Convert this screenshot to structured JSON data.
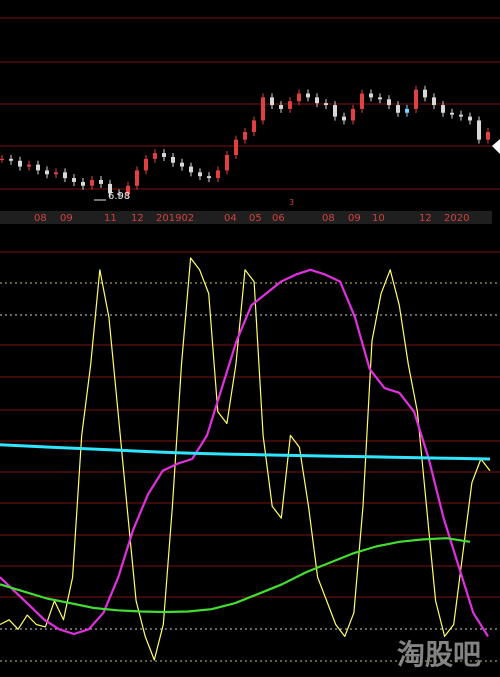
{
  "colors": {
    "background": "#000000",
    "grid_red": "#7a1414",
    "axis_bar": "#1f1f1f",
    "dotted_yellow": "#c8c070",
    "dotted_white": "#cfcfcf",
    "price_up": "#e04040",
    "price_down": "#d8d8d8",
    "price_gap": "#7fd4ff",
    "osc_yellow": "#ffff66",
    "magenta": "#e030e0",
    "cyan": "#2ee6ff",
    "green": "#44dd33",
    "watermark": "#9a9a9a",
    "label_white": "#e8e8e8",
    "tick_red": "#d04040"
  },
  "watermark": "淘股吧",
  "price_panel": {
    "low_label": "6.98",
    "marker_label": "3",
    "arrow_icon": "left-triangle-icon"
  },
  "chart_data": [
    {
      "type": "line",
      "title": "",
      "x_ticks": [
        "08",
        "09",
        "11",
        "12",
        "201902",
        "04",
        "05",
        "06",
        "08",
        "09",
        "10",
        "12",
        "2020"
      ],
      "series": [
        {
          "values": [
            7.9,
            7.85,
            7.7,
            7.75,
            7.6,
            7.5,
            7.55,
            7.4,
            7.3,
            7.2,
            7.35,
            7.25,
            7.0,
            6.98,
            7.2,
            7.6,
            7.9,
            8.05,
            7.95,
            7.8,
            7.7,
            7.55,
            7.45,
            7.4,
            7.6,
            8.0,
            8.4,
            8.6,
            8.9,
            9.5,
            9.3,
            9.2,
            9.4,
            9.6,
            9.5,
            9.35,
            9.3,
            9.0,
            8.9,
            9.2,
            9.6,
            9.5,
            9.45,
            9.3,
            9.1,
            9.2,
            9.7,
            9.5,
            9.3,
            9.1,
            9.05,
            9.0,
            8.9,
            8.4,
            8.6
          ]
        }
      ]
    },
    {
      "type": "line",
      "title": "",
      "series": [
        {
          "values": [
            10,
            12,
            8,
            14,
            10,
            9,
            20,
            12,
            30,
            90,
            120,
            160,
            140,
            100,
            60,
            20,
            5,
            -5,
            10,
            60,
            120,
            165,
            160,
            150,
            100,
            95,
            120,
            160,
            155,
            90,
            60,
            55,
            90,
            85,
            60,
            30,
            20,
            10,
            5,
            15,
            60,
            130,
            150,
            160,
            145,
            120,
            100,
            60,
            20,
            5,
            10,
            40,
            70,
            80,
            75
          ]
        },
        {
          "values": [
            30,
            24,
            18,
            12,
            8,
            6,
            8,
            15,
            30,
            50,
            65,
            75,
            78,
            80,
            90,
            110,
            130,
            145,
            150,
            155,
            158,
            160,
            158,
            155,
            140,
            118,
            110,
            108,
            100,
            80,
            55,
            35,
            15,
            5
          ]
        },
        {
          "values": [
            86,
            85.5,
            85,
            84.5,
            84,
            83.5,
            83,
            82.6,
            82.3,
            82,
            81.8,
            81.6,
            81.4,
            81.2,
            81,
            80.8,
            80.6,
            80.4,
            80.2,
            80
          ]
        },
        {
          "values": [
            27,
            24,
            21,
            19,
            17,
            16,
            15.5,
            15.3,
            15.5,
            16.5,
            19,
            23,
            27,
            32,
            36,
            40,
            43,
            45,
            46,
            46.5,
            45
          ]
        }
      ]
    }
  ]
}
